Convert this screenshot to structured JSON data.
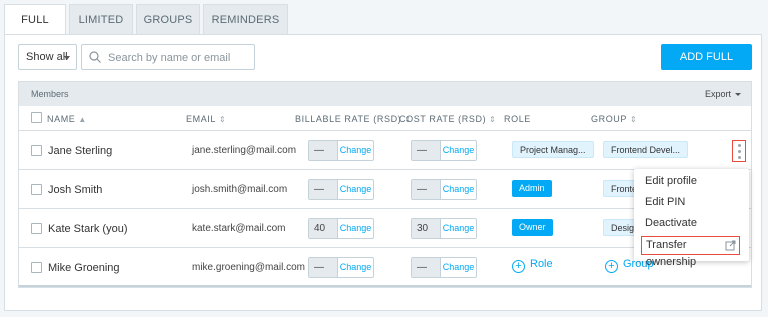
{
  "tabs": [
    "FULL",
    "LIMITED",
    "GROUPS",
    "REMINDERS"
  ],
  "toolbar": {
    "filter_value": "Show all",
    "search_placeholder": "Search by name or email",
    "add_button": "ADD FULL MEMBER"
  },
  "table": {
    "section_title": "Members",
    "export_label": "Export",
    "columns": [
      "NAME",
      "EMAIL",
      "BILLABLE RATE (RSD)",
      "COST RATE (RSD)",
      "ROLE",
      "GROUP"
    ],
    "rows": [
      {
        "name": "Jane Sterling",
        "email": "jane.sterling@mail.com",
        "billable": "—",
        "cost": "—",
        "role": "Project Manag...",
        "group": "Frontend Devel..."
      },
      {
        "name": "Josh Smith",
        "email": "josh.smith@mail.com",
        "billable": "—",
        "cost": "—",
        "role": "Admin",
        "group": "Fronten"
      },
      {
        "name": "Kate Stark (you)",
        "email": "kate.stark@mail.com",
        "billable": "40",
        "cost": "30",
        "role": "Owner",
        "group": "Designe"
      },
      {
        "name": "Mike Groening",
        "email": "mike.groening@mail.com",
        "billable": "—",
        "cost": "—",
        "role": "Role",
        "group": "Group"
      }
    ],
    "change_label": "Change"
  },
  "menu": {
    "items": [
      "Edit profile",
      "Edit PIN",
      "Deactivate",
      "Transfer ownership"
    ]
  },
  "colors": {
    "accent": "#03a9f4",
    "highlight": "#e74c3c"
  }
}
